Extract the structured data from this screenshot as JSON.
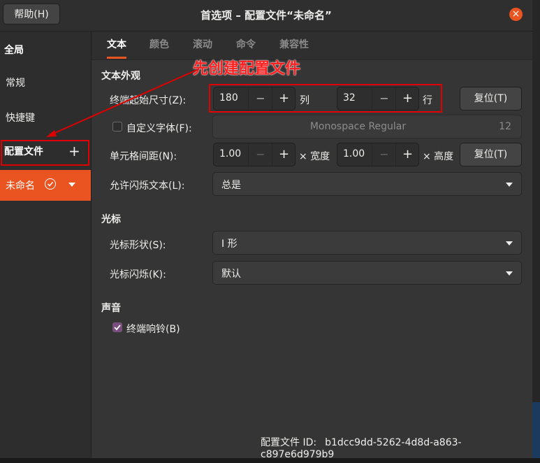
{
  "titlebar": {
    "help_label": "帮助(H)",
    "title": "首选项 – 配置文件“未命名”",
    "close_glyph": "×"
  },
  "sidebar": {
    "global_heading": "全局",
    "items": [
      {
        "label": "常规"
      },
      {
        "label": "快捷键"
      }
    ],
    "profiles_heading": "配置文件",
    "add_glyph": "+",
    "profile": {
      "name": "未命名"
    }
  },
  "tabs": [
    {
      "label": "文本",
      "active": true
    },
    {
      "label": "颜色",
      "active": false
    },
    {
      "label": "滚动",
      "active": false
    },
    {
      "label": "命令",
      "active": false
    },
    {
      "label": "兼容性",
      "active": false
    }
  ],
  "text_appearance": {
    "title": "文本外观",
    "initial_size": {
      "label": "终端起始尺寸(Z):",
      "columns": "180",
      "columns_unit": "列",
      "rows": "32",
      "rows_unit": "行",
      "reset_label": "复位(T)"
    },
    "custom_font": {
      "label": "自定义字体(F):",
      "checked": false,
      "font_name": "Monospace Regular",
      "font_size": "12"
    },
    "cell_spacing": {
      "label": "单元格间距(N):",
      "width_value": "1.00",
      "width_unit": "× 宽度",
      "height_value": "1.00",
      "height_unit": "× 高度",
      "reset_label": "复位(T)"
    },
    "blink_text": {
      "label": "允许闪烁文本(L):",
      "value": "总是"
    }
  },
  "cursor": {
    "title": "光标",
    "shape": {
      "label": "光标形状(S):",
      "value": "I 形"
    },
    "blink": {
      "label": "光标闪烁(K):",
      "value": "默认"
    }
  },
  "sound": {
    "title": "声音",
    "bell": {
      "label": "终端响铃(B)",
      "checked": true
    }
  },
  "footer": {
    "label": "配置文件 ID:",
    "value": "b1dcc9dd-5262-4d8d-a863-c897e6d979b9"
  },
  "annotation": {
    "text": "先创建配置文件",
    "color": "#e00000"
  },
  "colors": {
    "accent": "#e95420",
    "checkbox_on": "#7a4e7e",
    "background": "#353535"
  },
  "spin_glyphs": {
    "minus": "−",
    "plus": "+"
  }
}
